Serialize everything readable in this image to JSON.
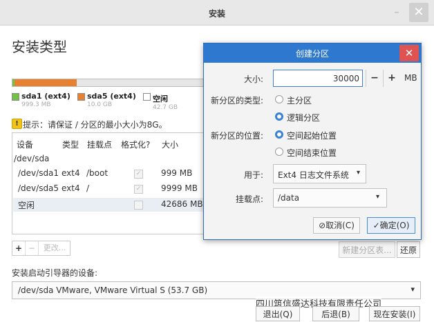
{
  "window": {
    "title": "安装",
    "minimize_glyph": "–",
    "close_glyph": "✕"
  },
  "page": {
    "title": "安装类型"
  },
  "partition_bar": {
    "colors": {
      "sda1": "#73c046",
      "sda5": "#e8812f",
      "free": "#e6e6e6"
    },
    "legend": [
      {
        "name": "sda1 (ext4)",
        "size": "999.3 MB"
      },
      {
        "name": "sda5 (ext4)",
        "size": "10.0 GB"
      },
      {
        "name": "空闲",
        "size": "42.7 GB"
      }
    ]
  },
  "hint": {
    "icon": "warning-icon",
    "glyph": "!",
    "text": "提示：请保证 / 分区的最小大小为8G。"
  },
  "table": {
    "headers": [
      "设备",
      "类型",
      "挂载点",
      "格式化?",
      "大小"
    ],
    "group": "/dev/sda",
    "rows": [
      {
        "device": "/dev/sda1",
        "type": "ext4",
        "mount": "/boot",
        "format": "✓",
        "size": "999 MB"
      },
      {
        "device": "/dev/sda5",
        "type": "ext4",
        "mount": "/",
        "format": "✓",
        "size": "9999 MB"
      },
      {
        "device": "空闲",
        "type": "",
        "mount": "",
        "format": "",
        "size": "42686 MB"
      }
    ]
  },
  "toolbar": {
    "add": "+",
    "remove": "−",
    "change": "更改..."
  },
  "buttons": {
    "new_table": "新建分区表...",
    "revert": "还原"
  },
  "boot": {
    "label": "安装启动引导器的设备:",
    "value": "/dev/sda   VMware, VMware Virtual S (53.7 GB)",
    "arrow": "▾"
  },
  "watermark": "四川筑信盛达科技有限责任公司",
  "bottom": {
    "quit": "退出(Q)",
    "back": "后退(B)",
    "install": "现在安装(I)"
  },
  "dialog": {
    "title": "创建分区",
    "close_glyph": "✕",
    "size_label": "大小:",
    "size_value": "30000",
    "minus": "−",
    "plus": "+",
    "unit": "MB",
    "type_label": "新分区的类型:",
    "type_options": [
      "主分区",
      "逻辑分区"
    ],
    "type_selected": "逻辑分区",
    "location_label": "新分区的位置:",
    "location_options": [
      "空间起始位置",
      "空间结束位置"
    ],
    "location_selected": "空间起始位置",
    "use_label": "用于:",
    "use_value": "Ext4 日志文件系统",
    "use_arrow": "▾",
    "mount_label": "挂载点:",
    "mount_value": "/data",
    "mount_arrow": "▾",
    "cancel": "取消(C)",
    "ok": "确定(O)"
  }
}
